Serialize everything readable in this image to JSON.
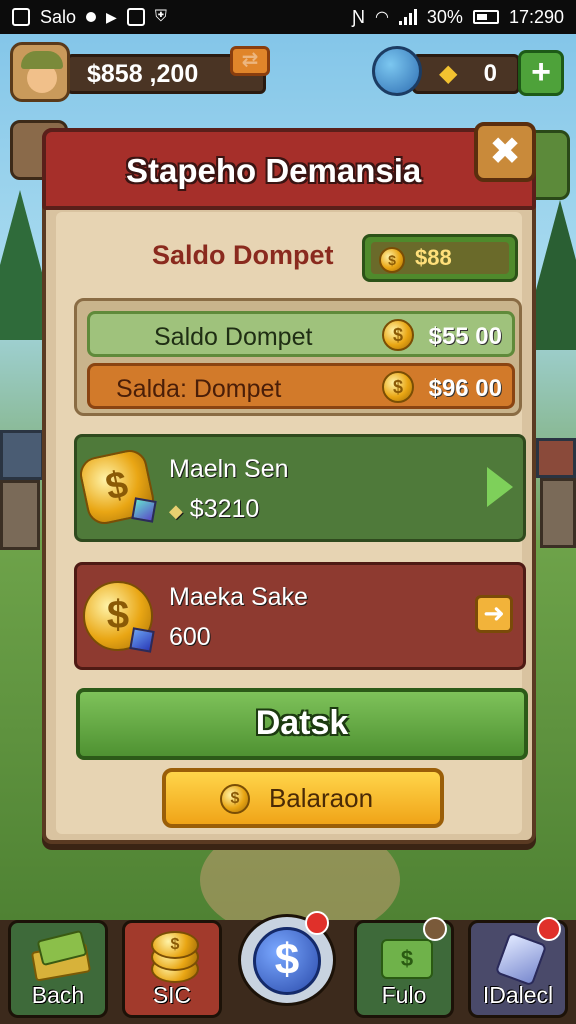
{
  "status_bar": {
    "carrier": "Salo",
    "battery_percent": "30%",
    "time": "17:290"
  },
  "hud": {
    "money": "$858 ,200",
    "gems": "0",
    "add_label": "+"
  },
  "panel": {
    "title": "Stapeho Demansia",
    "close_icon": "close-icon",
    "wallet": {
      "label": "Saldo Dompet",
      "value": "$88"
    },
    "balances": [
      {
        "label": "Saldo Dompet",
        "amount": "$55 00",
        "color": "#9fc27c"
      },
      {
        "label": "Salda: Dompet",
        "amount": "$96 00",
        "color": "#d27a2a"
      }
    ],
    "offers": [
      {
        "name": "Maeln Sen",
        "price": "$3210",
        "color": "#4f7a3a"
      },
      {
        "name": "Maeka Sake",
        "price": "600",
        "color": "#8e3a30"
      }
    ],
    "primary_button": "Datsk",
    "secondary_button": "Balaraon"
  },
  "bottom_nav": [
    {
      "label": "Bach",
      "icon": "cash-stack-icon",
      "badge": false
    },
    {
      "label": "SIC",
      "icon": "coin-stack-icon",
      "badge": false
    },
    {
      "label": "",
      "icon": "dollar-coin-icon",
      "badge": true
    },
    {
      "label": "Fulo",
      "icon": "banknote-icon",
      "badge": true
    },
    {
      "label": "IDalecl",
      "icon": "shield-gem-icon",
      "badge": true
    }
  ],
  "colors": {
    "header_red": "#a62f2a",
    "panel_tan": "#d9c3a0",
    "action_green": "#4f9232",
    "action_yellow": "#f0a418"
  }
}
